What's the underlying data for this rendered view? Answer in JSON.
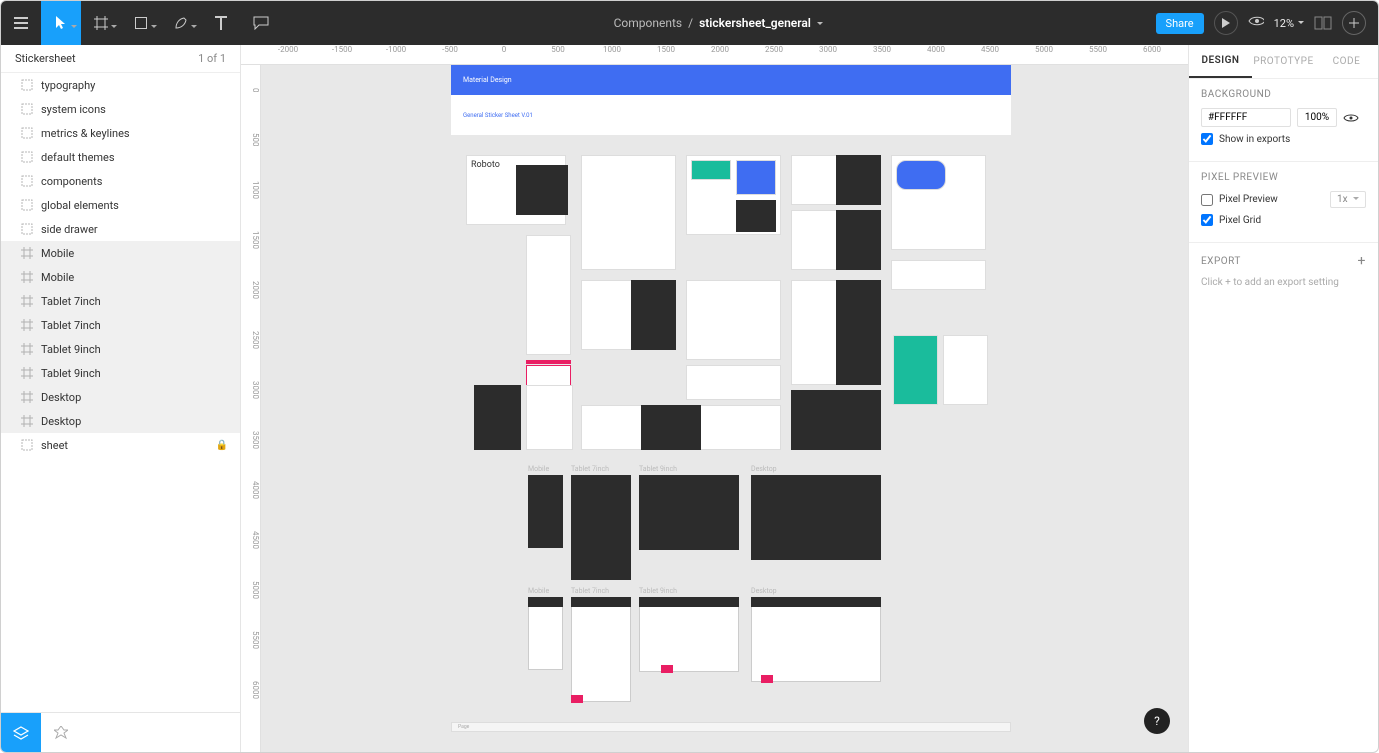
{
  "toolbar": {
    "breadcrumb_project": "Components",
    "breadcrumb_sep": "/",
    "breadcrumb_doc": "stickersheet_general",
    "share": "Share",
    "zoom": "12%"
  },
  "left": {
    "page_name": "Stickersheet",
    "page_count": "1 of 1",
    "layers": [
      {
        "name": "typography",
        "type": "component",
        "selected": false
      },
      {
        "name": "system icons",
        "type": "component",
        "selected": false
      },
      {
        "name": "metrics & keylines",
        "type": "component",
        "selected": false
      },
      {
        "name": "default themes",
        "type": "component",
        "selected": false
      },
      {
        "name": "components",
        "type": "component",
        "selected": false
      },
      {
        "name": "global elements",
        "type": "component",
        "selected": false
      },
      {
        "name": "side drawer",
        "type": "component",
        "selected": false
      },
      {
        "name": "Mobile",
        "type": "frame",
        "selected": true
      },
      {
        "name": "Mobile",
        "type": "frame",
        "selected": true
      },
      {
        "name": "Tablet 7inch",
        "type": "frame",
        "selected": true
      },
      {
        "name": "Tablet 7inch",
        "type": "frame",
        "selected": true
      },
      {
        "name": "Tablet 9inch",
        "type": "frame",
        "selected": true
      },
      {
        "name": "Tablet 9inch",
        "type": "frame",
        "selected": true
      },
      {
        "name": "Desktop",
        "type": "frame",
        "selected": true
      },
      {
        "name": "Desktop",
        "type": "frame",
        "selected": true
      },
      {
        "name": "sheet",
        "type": "component",
        "selected": false,
        "locked": true
      }
    ]
  },
  "canvas": {
    "ruler_h": [
      "-2000",
      "-1500",
      "-1000",
      "-500",
      "0",
      "500",
      "1000",
      "1500",
      "2000",
      "2500",
      "3000",
      "3500",
      "4000",
      "4500",
      "5000",
      "5500",
      "6000"
    ],
    "ruler_v": [
      "0",
      "500",
      "1000",
      "1500",
      "2000",
      "2500",
      "3000",
      "3500",
      "4000",
      "4500",
      "5000",
      "5500",
      "6000"
    ],
    "hero_title": "Material Design",
    "subhero_title": "General Sticker Sheet V.01",
    "roboto_label": "Roboto",
    "frames_row1": [
      "Mobile",
      "Tablet 7inch",
      "Tablet 9inch",
      "Desktop"
    ],
    "frames_row2": [
      "Mobile",
      "Tablet 7inch",
      "Tablet 9inch",
      "Desktop"
    ],
    "footer": "Page"
  },
  "right": {
    "tabs": [
      "DESIGN",
      "PROTOTYPE",
      "CODE"
    ],
    "active_tab": 0,
    "background_title": "BACKGROUND",
    "bg_color": "#FFFFFF",
    "bg_opacity": "100%",
    "show_in_exports": "Show in exports",
    "pixel_preview_title": "PIXEL PREVIEW",
    "pixel_preview": "Pixel Preview",
    "pixel_preview_scale": "1x",
    "pixel_grid": "Pixel Grid",
    "export_title": "EXPORT",
    "export_hint": "Click + to add an export setting"
  },
  "help": "?"
}
